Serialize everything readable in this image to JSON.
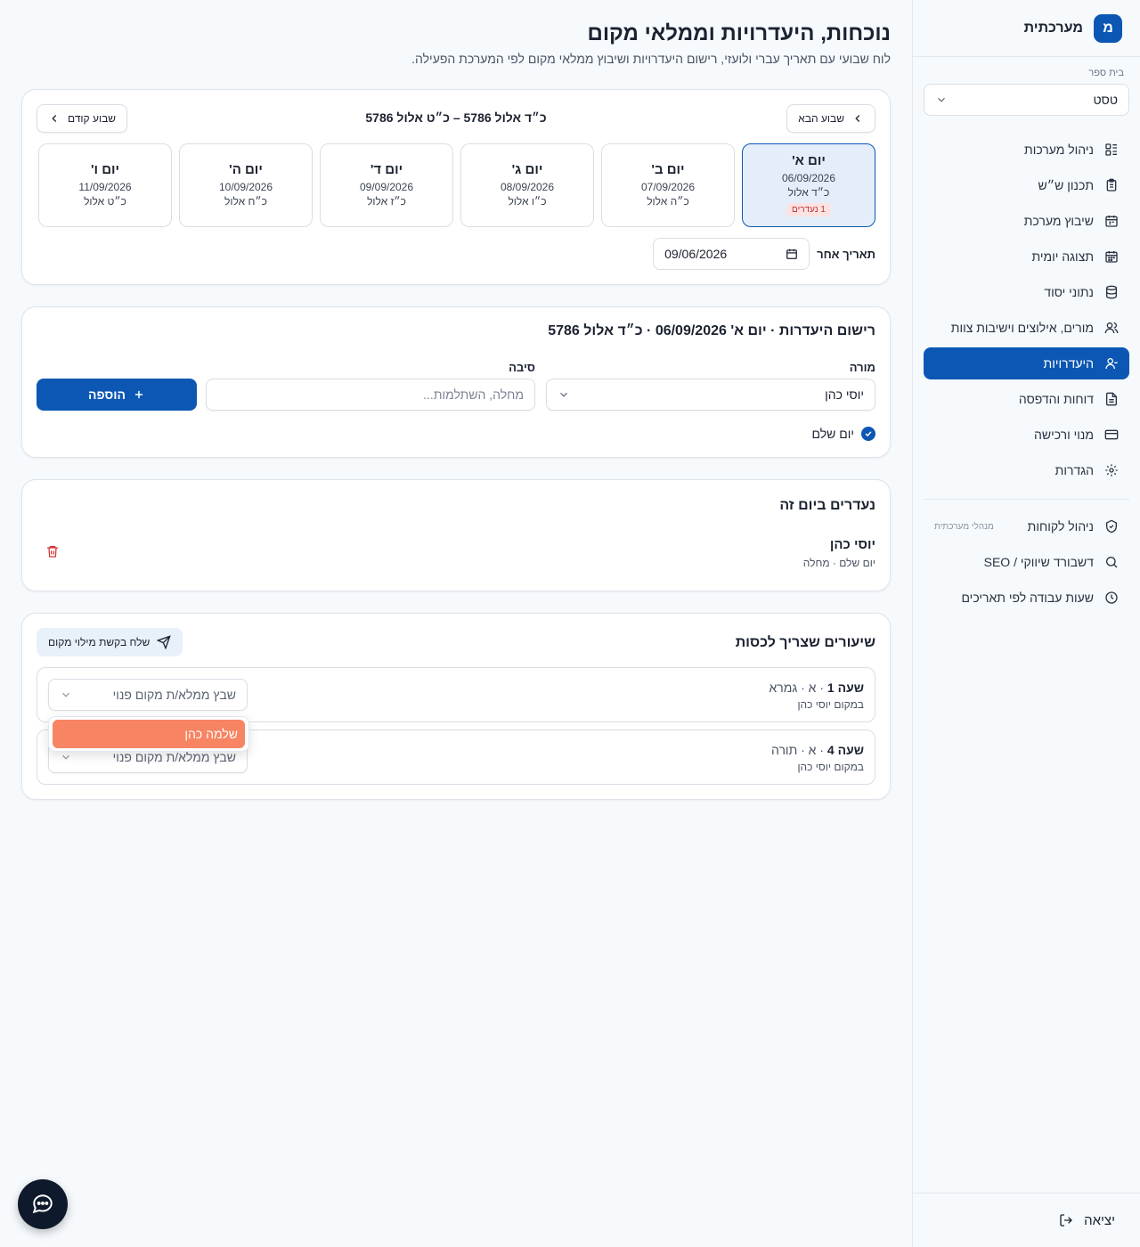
{
  "brand": {
    "logo_letter": "מ",
    "name": "מערכתית"
  },
  "sidebar": {
    "school_label": "בית ספר",
    "school_value": "טסט",
    "items": [
      {
        "label": "ניהול מערכות",
        "icon": "grid-list-icon"
      },
      {
        "label": "תכנון ש״ש",
        "icon": "clipboard-icon"
      },
      {
        "label": "שיבוץ מערכת",
        "icon": "calendar-icon"
      },
      {
        "label": "תצוגה יומית",
        "icon": "calendar-day-icon"
      },
      {
        "label": "נתוני יסוד",
        "icon": "database-icon"
      },
      {
        "label": "מורים, אילוצים וישיבות צוות",
        "icon": "users-icon"
      },
      {
        "label": "היעדרויות",
        "icon": "user-minus-icon"
      },
      {
        "label": "דוחות והדפסה",
        "icon": "document-icon"
      },
      {
        "label": "מנוי ורכישה",
        "icon": "credit-card-icon"
      },
      {
        "label": "הגדרות",
        "icon": "gear-icon"
      }
    ],
    "admin_items": [
      {
        "label": "ניהול לקוחות",
        "icon": "shield-icon",
        "badge": "מנהלי מערכתית"
      },
      {
        "label": "דשבורד שיווקי / SEO",
        "icon": "search-icon"
      },
      {
        "label": "שעות עבודה לפי תאריכים",
        "icon": "clock-icon"
      }
    ],
    "logout": "יציאה"
  },
  "page": {
    "title": "נוכחות, היעדרויות וממלאי מקום",
    "subtitle": "לוח שבועי עם תאריך עברי ולועזי, רישום היעדרויות ושיבוץ ממלאי מקום לפי המערכת הפעילה."
  },
  "week": {
    "next_label": "שבוע הבא",
    "prev_label": "שבוע קודם",
    "range": "כ״ד אלול 5786 – כ״ט אלול 5786",
    "days": [
      {
        "name": "יום א'",
        "date": "06/09/2026",
        "heb": "כ״ד אלול",
        "badge": "1 נעדרים"
      },
      {
        "name": "יום ב'",
        "date": "07/09/2026",
        "heb": "כ״ה אלול"
      },
      {
        "name": "יום ג'",
        "date": "08/09/2026",
        "heb": "כ״ו אלול"
      },
      {
        "name": "יום ד'",
        "date": "09/09/2026",
        "heb": "כ״ז אלול"
      },
      {
        "name": "יום ה'",
        "date": "10/09/2026",
        "heb": "כ״ח אלול"
      },
      {
        "name": "יום ו'",
        "date": "11/09/2026",
        "heb": "כ״ט אלול"
      }
    ],
    "other_date_label": "תאריך אחר",
    "other_date_value": "09/06/2026"
  },
  "absence_form": {
    "title": "רישום היעדרות · יום א' 06/09/2026 · כ״ד אלול 5786",
    "teacher_label": "מורה",
    "teacher_value": "יוסי כהן",
    "reason_label": "סיבה",
    "reason_placeholder": "מחלה, השתלמות...",
    "add_label": "הוספה",
    "full_day_label": "יום שלם"
  },
  "absent_list": {
    "title": "נעדרים ביום זה",
    "rows": [
      {
        "name": "יוסי כהן",
        "detail": "יום שלם · מחלה"
      }
    ]
  },
  "lessons": {
    "title": "שיעורים שצריך לכסות",
    "send_label": "שלח בקשת מילוי מקום",
    "items": [
      {
        "hour_label": "שעה 1",
        "class_subject": " · א · גמרא",
        "instead": "במקום יוסי כהן",
        "select_placeholder": "שבץ ממלא/ת מקום פנוי"
      },
      {
        "hour_label": "שעה 4",
        "class_subject": " · א · תורה",
        "instead": "במקום יוסי כהן",
        "select_placeholder": "שבץ ממלא/ת מקום פנוי"
      }
    ],
    "dropdown_option": "שלמה כהן"
  },
  "colors": {
    "primary": "#0b57b3",
    "danger": "#d23b3b",
    "highlight": "#f78462",
    "fab": "#0e1a2b"
  }
}
